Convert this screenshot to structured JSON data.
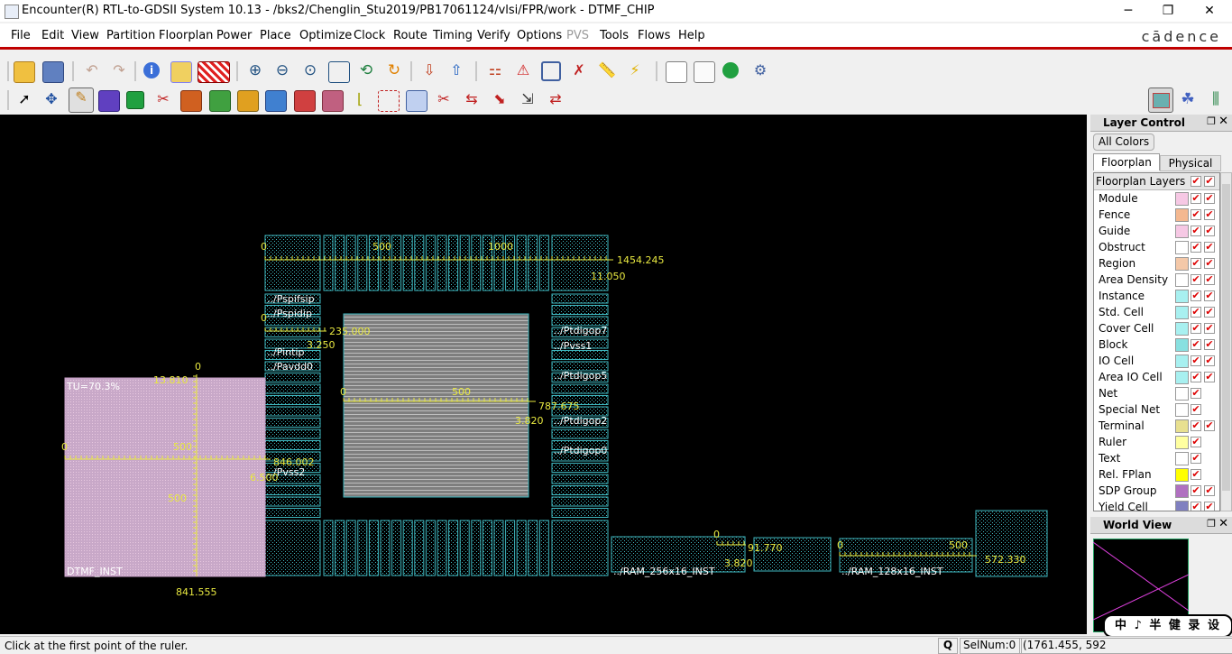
{
  "window": {
    "title": "Encounter(R) RTL-to-GDSII System 10.13 - /bks2/Chenglin_Stu2019/PB17061124/vlsi/FPR/work - DTMF_CHIP",
    "minimize": "─",
    "maximize": "❐",
    "close": "✕"
  },
  "menu": {
    "items": [
      "File",
      "Edit",
      "View",
      "Partition",
      "Floorplan",
      "Power",
      "Place",
      "Optimize",
      "Clock",
      "Route",
      "Timing",
      "Verify",
      "Options",
      "PVS",
      "Tools",
      "Flows",
      "Help"
    ],
    "disabled": [
      "PVS"
    ],
    "brand": "cādence"
  },
  "toolbar1": {
    "icons": [
      "open-icon",
      "save-icon",
      "undo-icon",
      "redo-icon",
      "info-icon",
      "select-color-icon",
      "pattern-icon",
      "zoom-in-icon",
      "zoom-out-icon",
      "zoom-fit-icon",
      "zoom-area-icon",
      "zoom-prev-icon",
      "redraw-icon",
      "import-icon",
      "export-icon",
      "hierarchy-icon",
      "warning-icon",
      "window-icon",
      "delete-icon",
      "ruler-icon",
      "highlight-icon",
      "notes-icon",
      "report-icon",
      "run-icon",
      "settings-icon"
    ]
  },
  "toolbar2": {
    "icons": [
      "pointer-icon",
      "move-icon",
      "ruler-tool-icon",
      "floorplan-icon",
      "add-block-icon",
      "cut-icon",
      "add-module-icon",
      "add-group-icon",
      "add-region-icon",
      "resize-icon",
      "add-inst-icon",
      "add-pin-icon",
      "snap-icon",
      "select-area-icon",
      "stretch-icon",
      "scissors-icon",
      "spacing-icon",
      "align-icon",
      "flip-icon",
      "swap-icon"
    ],
    "views": [
      "floorplan-view-icon",
      "amoeba-view-icon",
      "physical-view-icon"
    ]
  },
  "layout_view": {
    "pins": [
      "../Pspifsip",
      "../Pspidip",
      "../Pintip",
      "../Pavdd0",
      "../Pvss2",
      "../Ptdigop7",
      "../Pvss1",
      "../Ptdigop5",
      "../Ptdigop2",
      "../Ptdigop0"
    ],
    "rulers": [
      {
        "start": "0",
        "mid": "500",
        "mid2": "1000",
        "end": "1454.245",
        "sub": "11.050"
      },
      {
        "start": "0",
        "end": "235.000",
        "sub": "3.250"
      },
      {
        "start": "0",
        "mid": "500",
        "end": "787.675",
        "sub": "3.820"
      },
      {
        "start": "0",
        "mid": "500",
        "end": "846.002",
        "sub": "6.500"
      },
      {
        "start": "0",
        "end": "91.770",
        "sub": "3.820"
      },
      {
        "start": "0",
        "mid": "500",
        "end": "572.330"
      }
    ],
    "vertical_ruler": {
      "top": "0",
      "tick1": "500",
      "tick2": "500",
      "left_label": "13.810",
      "bottom_label": "841.555"
    },
    "dtmf_block": {
      "tu": "TU=70.3%",
      "name": "DTMF_INST"
    },
    "ram1": "../RAM_256x16_INST",
    "ram2": "../RAM_128x16_INST"
  },
  "layer_control": {
    "title": "Layer Control",
    "all_colors": "All Colors",
    "tabs": [
      "Floorplan",
      "Physical"
    ],
    "header": "Floorplan Layers",
    "layers": [
      {
        "name": "Module",
        "color": "#f6c8e4",
        "two": true
      },
      {
        "name": "Fence",
        "color": "#f4b890",
        "two": true
      },
      {
        "name": "Guide",
        "color": "#f6c8e4",
        "two": true
      },
      {
        "name": "Obstruct",
        "color": "#ffffff",
        "two": true
      },
      {
        "name": "Region",
        "color": "#f4c8a8",
        "two": true
      },
      {
        "name": "Area Density",
        "color": "#ffffff",
        "two": true
      },
      {
        "name": "Instance",
        "color": "#a8f0f0",
        "two": true
      },
      {
        "name": "Std. Cell",
        "color": "#a8f0f0",
        "two": true
      },
      {
        "name": "Cover Cell",
        "color": "#a8f0f0",
        "two": true
      },
      {
        "name": "Block",
        "color": "#88e0e0",
        "two": true
      },
      {
        "name": "IO Cell",
        "color": "#a8f0f0",
        "two": true
      },
      {
        "name": "Area IO Cell",
        "color": "#a8f0f0",
        "two": true
      },
      {
        "name": "Net",
        "color": "#ffffff",
        "two": false
      },
      {
        "name": "Special Net",
        "color": "#ffffff",
        "two": false
      },
      {
        "name": "Terminal",
        "color": "#e8e090",
        "two": true
      },
      {
        "name": "Ruler",
        "color": "#ffffa0",
        "two": false
      },
      {
        "name": "Text",
        "color": "#ffffff",
        "two": false
      },
      {
        "name": "Rel. FPlan",
        "color": "#ffff00",
        "two": false
      },
      {
        "name": "SDP Group",
        "color": "#b070c0",
        "two": true
      },
      {
        "name": "Yield Cell",
        "color": "#8080c0",
        "two": true
      }
    ]
  },
  "world_view": {
    "title": "World View",
    "badge": "中 ♪ 半 健 录 设"
  },
  "status": {
    "message": "Click at the first point of the ruler.",
    "q_label": "Q",
    "selnum": "SelNum:0",
    "coords": "(1761.455, 592"
  }
}
